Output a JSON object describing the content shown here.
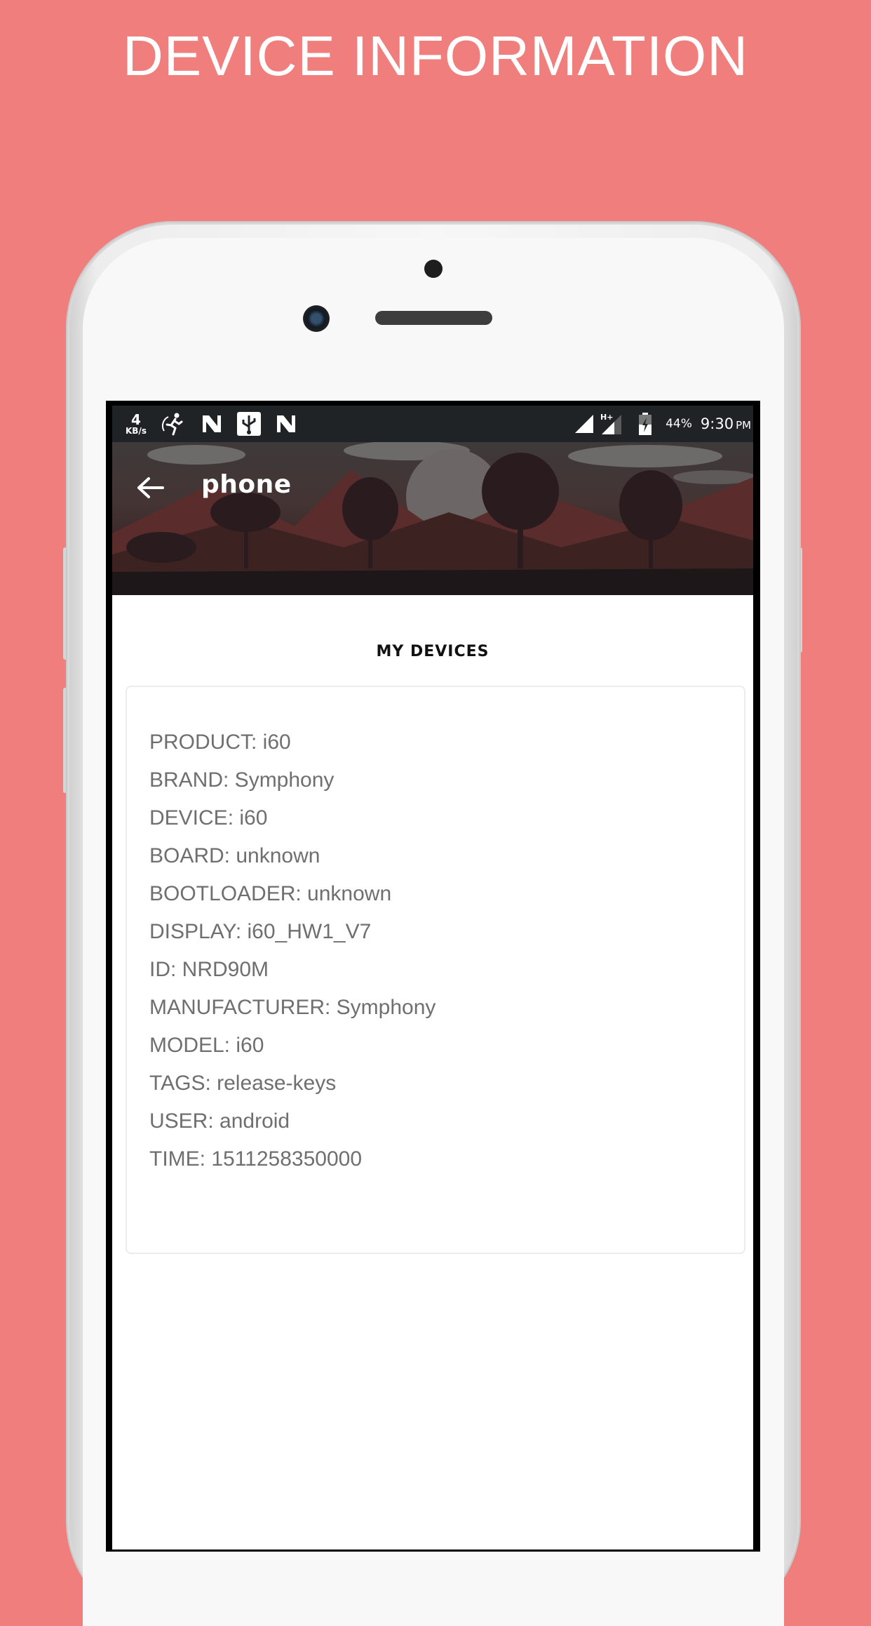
{
  "promo": {
    "title": "DEVICE INFORMATION"
  },
  "colors": {
    "background": "#f07e7d",
    "statusbar": "#1f2326",
    "text_gray": "#6f6f6f"
  },
  "statusbar": {
    "speed_value": "4",
    "speed_unit": "KB/s",
    "left_icons": [
      "running-man-icon",
      "n-notification-icon",
      "usb-icon",
      "n-notification-icon"
    ],
    "right_icons": [
      "signal-icon",
      "h-plus-signal-icon",
      "battery-charging-icon"
    ],
    "battery": "44%",
    "time": "9:30",
    "ampm": "PM"
  },
  "toolbar": {
    "back_icon": "arrow-left-icon",
    "title": "phone"
  },
  "section": {
    "title": "MY DEVICES"
  },
  "device_info": [
    {
      "text": "PRODUCT: i60"
    },
    {
      "text": "BRAND: Symphony"
    },
    {
      "text": "DEVICE: i60"
    },
    {
      "text": "BOARD: unknown"
    },
    {
      "text": "BOOTLOADER: unknown"
    },
    {
      "text": "DISPLAY: i60_HW1_V7"
    },
    {
      "text": "ID: NRD90M"
    },
    {
      "text": "MANUFACTURER: Symphony"
    },
    {
      "text": "MODEL: i60"
    },
    {
      "text": "TAGS: release-keys"
    },
    {
      "text": "USER: android"
    },
    {
      "text": "TIME: 1511258350000"
    }
  ]
}
